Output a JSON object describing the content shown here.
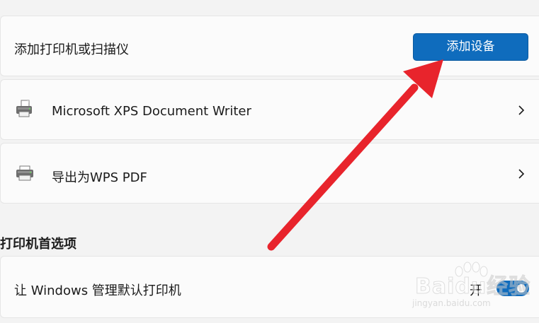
{
  "add_section": {
    "label": "添加打印机或扫描仪",
    "button_label": "添加设备"
  },
  "printers": [
    {
      "name": "Microsoft XPS Document Writer",
      "icon": "printer-document-icon"
    },
    {
      "name": "导出为WPS PDF",
      "icon": "printer-icon"
    }
  ],
  "preferences": {
    "title": "打印机首选项",
    "manage_default_label": "让 Windows 管理默认打印机",
    "toggle_state": "开",
    "toggle_on": true
  },
  "watermark": {
    "main": "Baidu经验",
    "sub": "jingyan.baidu.com"
  },
  "colors": {
    "accent": "#0f6cbd",
    "annotation_arrow": "#e8242c"
  }
}
